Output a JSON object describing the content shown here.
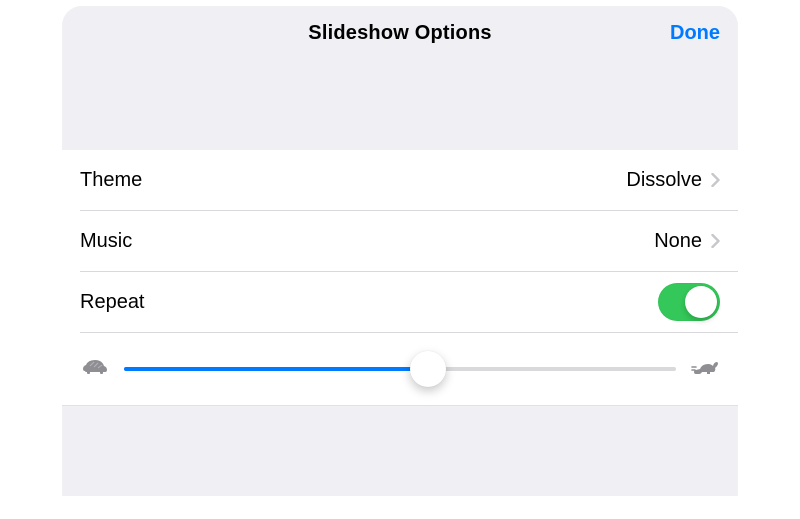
{
  "nav": {
    "title": "Slideshow Options",
    "done": "Done"
  },
  "rows": {
    "theme": {
      "label": "Theme",
      "value": "Dissolve"
    },
    "music": {
      "label": "Music",
      "value": "None"
    },
    "repeat": {
      "label": "Repeat",
      "on": true
    }
  },
  "slider": {
    "percent": 55
  },
  "colors": {
    "accent": "#007aff",
    "toggle_on": "#34c759",
    "sheet_bg": "#efeff4",
    "secondary": "#8e8e93"
  }
}
